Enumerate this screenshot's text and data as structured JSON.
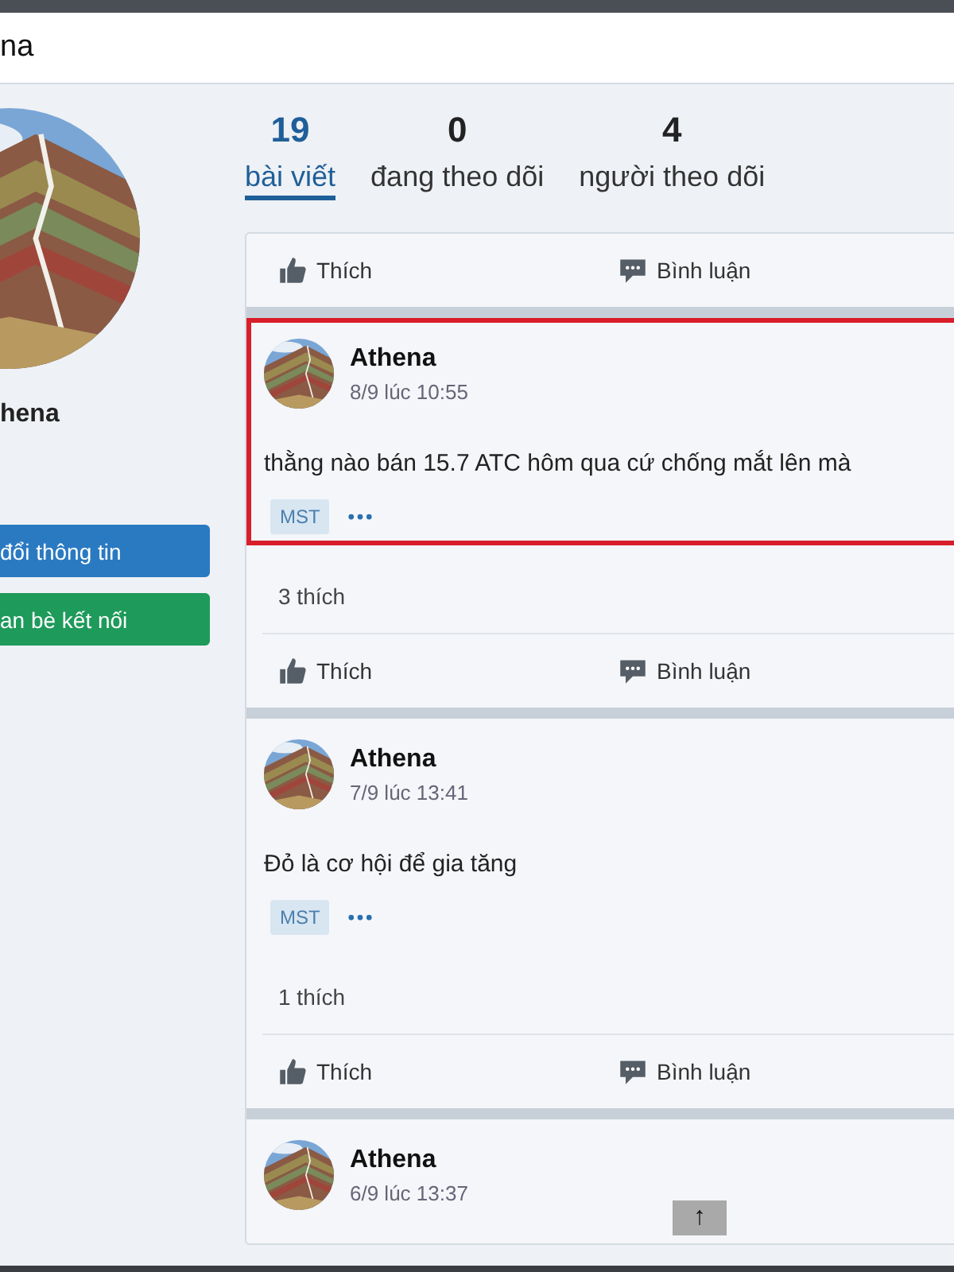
{
  "window": {
    "title": "na"
  },
  "profile": {
    "name": "hena",
    "buttons": [
      {
        "label": "đổi thông tin",
        "kind": "primary"
      },
      {
        "label": "an bè kết nối",
        "kind": "success"
      }
    ]
  },
  "stats": [
    {
      "count": "19",
      "label": "bài viết",
      "selected": true
    },
    {
      "count": "0",
      "label": "đang theo dõi",
      "selected": false
    },
    {
      "count": "4",
      "label": "người theo dõi",
      "selected": false
    }
  ],
  "posts": [
    {
      "kind": "actions_only",
      "actions": [
        "Thích",
        "Bình luận"
      ]
    },
    {
      "kind": "full",
      "author": "Athena",
      "time": "8/9 lúc 10:55",
      "text": "thằng nào bán 15.7 ATC hôm qua cứ chống mắt lên mà",
      "tag": "MST",
      "likes": "3 thích",
      "highlighted": true,
      "actions": [
        "Thích",
        "Bình luận"
      ]
    },
    {
      "kind": "full",
      "author": "Athena",
      "time": "7/9 lúc 13:41",
      "text": "Đỏ là cơ hội để gia tăng",
      "tag": "MST",
      "likes": "1 thích",
      "highlighted": false,
      "actions": [
        "Thích",
        "Bình luận"
      ]
    },
    {
      "kind": "header_only",
      "author": "Athena",
      "time": "6/9 lúc 13:37"
    }
  ],
  "scroll_top": {
    "label": "↑"
  }
}
